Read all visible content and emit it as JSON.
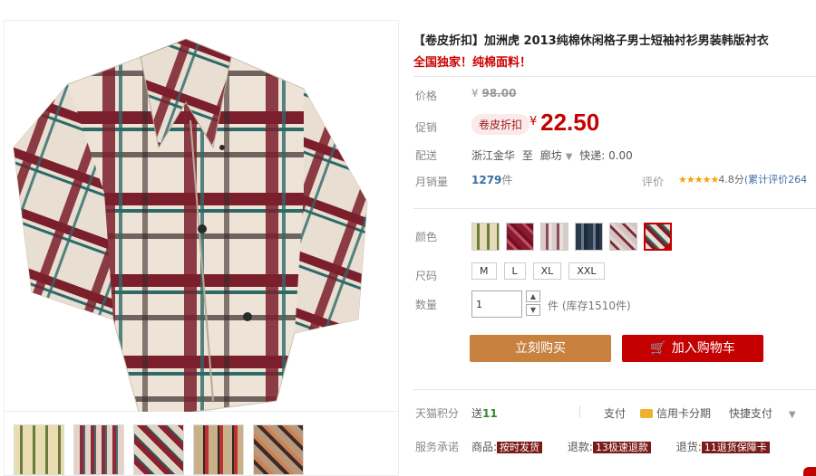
{
  "product": {
    "title": "【卷皮折扣】加洲虎 2013纯棉休闲格子男士短袖衬衫男装韩版衬衣",
    "subtitle": "全国独家！纯棉面料！"
  },
  "price": {
    "label": "价格",
    "currency": "¥",
    "original": "98.00"
  },
  "promo": {
    "label": "促销",
    "badge": "卷皮折扣",
    "currency": "¥",
    "value": "22.50"
  },
  "shipping": {
    "label": "配送",
    "from": "浙江金华",
    "to_word": "至",
    "dest": "廊坊",
    "fee": "快递: 0.00"
  },
  "sales": {
    "label": "月销量",
    "count": "1279",
    "unit": "件"
  },
  "rating": {
    "label": "评价",
    "stars": "★★★★★",
    "score": "4.8分",
    "reviews": "(累计评价264"
  },
  "color": {
    "label": "颜色",
    "swatch_count": 6,
    "selected_index": 5
  },
  "size": {
    "label": "尺码",
    "options": [
      "M",
      "L",
      "XL",
      "XXL"
    ]
  },
  "quantity": {
    "label": "数量",
    "value": "1",
    "stock": "件 (库存1510件)"
  },
  "actions": {
    "buy_now": "立刻购买",
    "add_cart": "加入购物车"
  },
  "tmall_points": {
    "label": "天猫积分",
    "prefix": "送",
    "value": "11"
  },
  "payment": {
    "label": "支付",
    "card": "信用卡分期",
    "quick": "快捷支付"
  },
  "service": {
    "label": "服务承诺",
    "item1_prefix": "商品:",
    "item1_tag": "按时发货",
    "item2_prefix": "退款:",
    "item2_tag": "13极速退款",
    "item3_prefix": "退货:",
    "item3_tag": "11退货保障卡"
  },
  "colors": {
    "accent": "#c40000",
    "buy_button": "#c8813f",
    "sales_blue": "#3c6ea5"
  }
}
